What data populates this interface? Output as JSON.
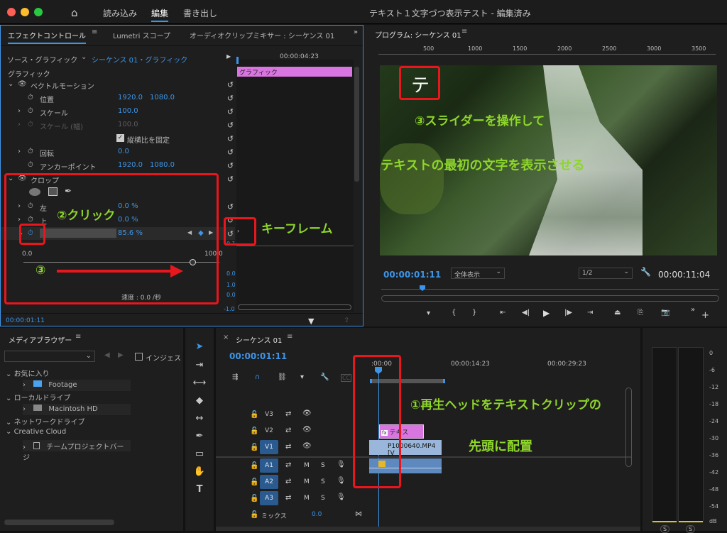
{
  "titlebar": {
    "tabs": [
      "読み込み",
      "編集",
      "書き出し"
    ],
    "window_title": "テキスト１文字づつ表示テスト - 編集済み"
  },
  "effect_controls": {
    "tabs": [
      "エフェクトコントロール",
      "Lumetri スコープ",
      "オーディオクリップミキサー : シーケンス 01"
    ],
    "source": "ソース・グラフィック",
    "sequence": "シーケンス 01・グラフィック",
    "ruler_time": "00:00:04:23",
    "section": "グラフィック",
    "clip_label": "グラフィック",
    "vector_motion": "ベクトルモーション",
    "props": [
      {
        "name": "位置",
        "v1": "1920.0",
        "v2": "1080.0"
      },
      {
        "name": "スケール",
        "v1": "100.0",
        "v2": ""
      },
      {
        "name": "スケール (幅)",
        "v1": "100.0",
        "v2": ""
      },
      {
        "name": "縦横比を固定",
        "v1": "",
        "v2": ""
      },
      {
        "name": "回転",
        "v1": "0.0",
        "v2": ""
      },
      {
        "name": "アンカーポイント",
        "v1": "1920.0",
        "v2": "1080.0"
      }
    ],
    "crop": "クロップ",
    "crop_left": "左",
    "crop_left_val": "0.0 %",
    "crop_top": "上",
    "crop_top_val": "0.0 %",
    "crop_right_val": "85.6 %",
    "slider_min": "0.0",
    "slider_max": "100.0",
    "graph_vals": [
      "0.1",
      "0.0",
      "1.0",
      "0.0",
      "-1.0"
    ],
    "speed": "速度 : 0.0 /秒",
    "timecode": "00:00:01:11"
  },
  "program": {
    "title": "プログラム: シーケンス 01",
    "ruler": [
      "500",
      "1000",
      "1500",
      "2000",
      "2500",
      "3000",
      "3500"
    ],
    "overlay_char": "テ",
    "timecode": "00:00:01:11",
    "fit": "全体表示",
    "resolution": "1/2",
    "duration": "00:00:11:04"
  },
  "media_browser": {
    "title": "メディアブラウザー",
    "ingest": "インジェス",
    "favorites": "お気に入り",
    "footage": "Footage",
    "local": "ローカルドライブ",
    "mac": "Macintosh HD",
    "network": "ネットワークドライブ",
    "cc": "Creative Cloud",
    "team": "チームプロジェクトバージ"
  },
  "timeline": {
    "title": "シーケンス 01",
    "timecode": "00:00:01:11",
    "ruler": [
      ":00:00",
      "00:00:14:23",
      "00:00:29:23"
    ],
    "tracks": [
      "V3",
      "V2",
      "V1",
      "A1",
      "A2",
      "A3"
    ],
    "mix": "ミックス",
    "mix_val": "0.0",
    "text_clip": "テキス",
    "video_clip": "P1000640.MP4 [V",
    "fx": "fx"
  },
  "meter": {
    "scale": [
      "0",
      "-6",
      "-12",
      "-18",
      "-24",
      "-30",
      "-36",
      "-42",
      "-48",
      "-54",
      "dB"
    ],
    "solo": [
      "S",
      "S"
    ]
  },
  "annotations": {
    "step1_line1": "①再生ヘッドをテキストクリップの",
    "step1_line2": "先頭に配置",
    "step2": "②クリック",
    "step3_num": "③",
    "step3_line1": "③スライダーを操作して",
    "step3_line2": "テキストの最初の文字を表示させる",
    "keyframe": "キーフレーム"
  },
  "colors": {
    "accent": "#3d95e8",
    "annotation_red": "#e8161d",
    "annotation_green": "#8ed62a",
    "graphic_clip": "#d975e1",
    "track_blue": "#2b5a8f"
  }
}
